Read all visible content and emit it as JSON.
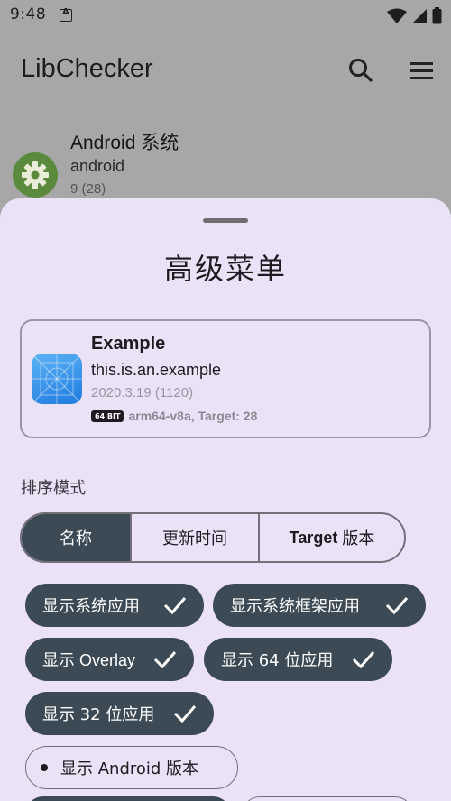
{
  "status_bar": {
    "time": "9:48"
  },
  "app_bar": {
    "title": "LibChecker"
  },
  "list": {
    "item": {
      "name": "Android 系统",
      "package": "android",
      "version": "9 (28)"
    }
  },
  "sheet": {
    "title": "高级菜单",
    "example": {
      "name": "Example",
      "package": "this.is.an.example",
      "version": "2020.3.19 (1120)",
      "abi_badge": "64 BIT",
      "abi_info": "arm64-v8a, Target: 28"
    },
    "sort_label": "排序模式",
    "sort_options": [
      "名称",
      "更新时间",
      "Target 版本"
    ],
    "sort_option_3_latin": "Target",
    "sort_option_3_cjk": "版本",
    "filters": [
      {
        "label": "显示系统应用",
        "checked": true
      },
      {
        "label": "显示系统框架应用",
        "checked": true
      },
      {
        "label": "显示 Overlay",
        "checked": true
      },
      {
        "label": "显示 64 位应用",
        "checked": true
      },
      {
        "label": "显示 32 位应用",
        "checked": true
      },
      {
        "label": "显示 Android 版本",
        "checked": false
      }
    ]
  },
  "colors": {
    "chip_selected": "#3b4a55",
    "sheet_background": "#ece2f7",
    "scrim": "#a7a7a7",
    "settings_icon_bg": "#5b8a3e"
  }
}
